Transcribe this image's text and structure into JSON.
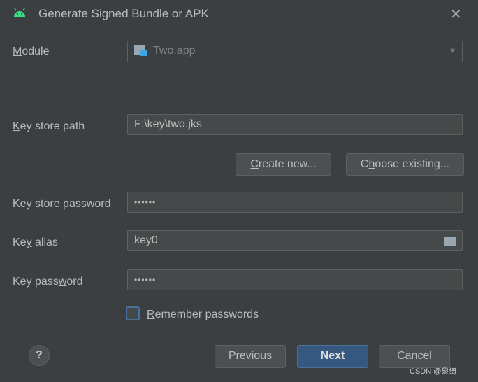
{
  "title": "Generate Signed Bundle or APK",
  "module": {
    "label": [
      "",
      "M",
      "odule"
    ],
    "value": "Two.app"
  },
  "keystore_path": {
    "label": [
      "",
      "K",
      "ey store path"
    ],
    "value": "F:\\key\\two.jks"
  },
  "create_new": [
    "",
    "C",
    "reate new..."
  ],
  "choose_existing": [
    "C",
    "h",
    "oose existing..."
  ],
  "keystore_password": {
    "label": [
      "Key store ",
      "p",
      "assword"
    ],
    "value": "••••••"
  },
  "key_alias": {
    "label": [
      "Ke",
      "y",
      " alias"
    ],
    "value": "key0"
  },
  "key_password": {
    "label": [
      "Key pass",
      "w",
      "ord"
    ],
    "value": "••••••"
  },
  "remember": {
    "label": [
      "",
      "R",
      "emember passwords"
    ],
    "checked": false
  },
  "buttons": {
    "previous": [
      "",
      "P",
      "revious"
    ],
    "next": [
      "",
      "N",
      "ext"
    ],
    "cancel": "Cancel",
    "help": "?"
  },
  "watermark": "CSDN @泉绮",
  "colors": {
    "android": "#3ddc84",
    "accent": "#365880",
    "module_icon": "#3aa8e0"
  }
}
